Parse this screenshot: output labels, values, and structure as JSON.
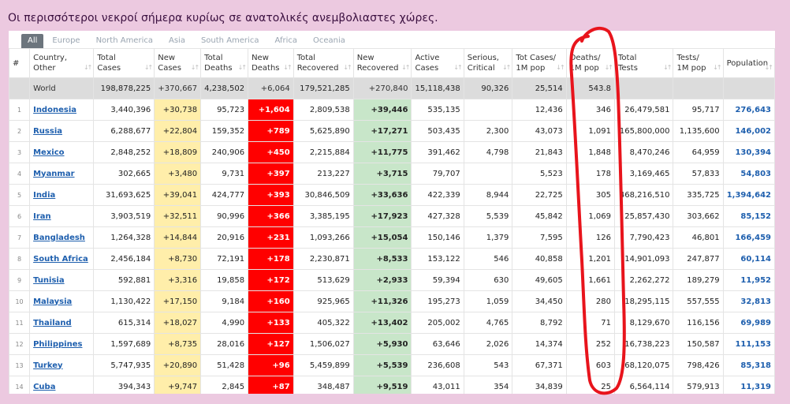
{
  "caption": "Οι περισσότεροι νεκροί σήμερα κυρίως σε ανατολικές ανεμβολιαστες χώρες.",
  "tabs": [
    "All",
    "Europe",
    "North America",
    "Asia",
    "South America",
    "Africa",
    "Oceania"
  ],
  "headers": [
    "#",
    "Country,\nOther",
    "Total\nCases",
    "New\nCases",
    "Total\nDeaths",
    "New\nDeaths",
    "Total\nRecovered",
    "New\nRecovered",
    "Active\nCases",
    "Serious,\nCritical",
    "Tot Cases/\n1M pop",
    "Deaths/\n1M pop",
    "Total\nTests",
    "Tests/\n1M pop",
    "Population"
  ],
  "world": [
    "",
    "World",
    "198,878,225",
    "+370,667",
    "4,238,502",
    "+6,064",
    "179,521,285",
    "+270,840",
    "15,118,438",
    "90,326",
    "25,514",
    "543.8",
    "",
    "",
    ""
  ],
  "rows": [
    [
      "1",
      "Indonesia",
      "3,440,396",
      "+30,738",
      "95,723",
      "+1,604",
      "2,809,538",
      "+39,446",
      "535,135",
      "",
      "12,436",
      "346",
      "26,479,581",
      "95,717",
      "276,643"
    ],
    [
      "2",
      "Russia",
      "6,288,677",
      "+22,804",
      "159,352",
      "+789",
      "5,625,890",
      "+17,271",
      "503,435",
      "2,300",
      "43,073",
      "1,091",
      "165,800,000",
      "1,135,600",
      "146,002"
    ],
    [
      "3",
      "Mexico",
      "2,848,252",
      "+18,809",
      "240,906",
      "+450",
      "2,215,884",
      "+11,775",
      "391,462",
      "4,798",
      "21,843",
      "1,848",
      "8,470,246",
      "64,959",
      "130,394"
    ],
    [
      "4",
      "Myanmar",
      "302,665",
      "+3,480",
      "9,731",
      "+397",
      "213,227",
      "+3,715",
      "79,707",
      "",
      "5,523",
      "178",
      "3,169,465",
      "57,833",
      "54,803"
    ],
    [
      "5",
      "India",
      "31,693,625",
      "+39,041",
      "424,777",
      "+393",
      "30,846,509",
      "+33,636",
      "422,339",
      "8,944",
      "22,725",
      "305",
      "468,216,510",
      "335,725",
      "1,394,642"
    ],
    [
      "6",
      "Iran",
      "3,903,519",
      "+32,511",
      "90,996",
      "+366",
      "3,385,195",
      "+17,923",
      "427,328",
      "5,539",
      "45,842",
      "1,069",
      "25,857,430",
      "303,662",
      "85,152"
    ],
    [
      "7",
      "Bangladesh",
      "1,264,328",
      "+14,844",
      "20,916",
      "+231",
      "1,093,266",
      "+15,054",
      "150,146",
      "1,379",
      "7,595",
      "126",
      "7,790,423",
      "46,801",
      "166,459"
    ],
    [
      "8",
      "South Africa",
      "2,456,184",
      "+8,730",
      "72,191",
      "+178",
      "2,230,871",
      "+8,533",
      "153,122",
      "546",
      "40,858",
      "1,201",
      "14,901,093",
      "247,877",
      "60,114"
    ],
    [
      "9",
      "Tunisia",
      "592,881",
      "+3,316",
      "19,858",
      "+172",
      "513,629",
      "+2,933",
      "59,394",
      "630",
      "49,605",
      "1,661",
      "2,262,272",
      "189,279",
      "11,952"
    ],
    [
      "10",
      "Malaysia",
      "1,130,422",
      "+17,150",
      "9,184",
      "+160",
      "925,965",
      "+11,326",
      "195,273",
      "1,059",
      "34,450",
      "280",
      "18,295,115",
      "557,555",
      "32,813"
    ],
    [
      "11",
      "Thailand",
      "615,314",
      "+18,027",
      "4,990",
      "+133",
      "405,322",
      "+13,402",
      "205,002",
      "4,765",
      "8,792",
      "71",
      "8,129,670",
      "116,156",
      "69,989"
    ],
    [
      "12",
      "Philippines",
      "1,597,689",
      "+8,735",
      "28,016",
      "+127",
      "1,506,027",
      "+5,930",
      "63,646",
      "2,026",
      "14,374",
      "252",
      "16,738,223",
      "150,587",
      "111,153"
    ],
    [
      "13",
      "Turkey",
      "5,747,935",
      "+20,890",
      "51,428",
      "+96",
      "5,459,899",
      "+5,539",
      "236,608",
      "543",
      "67,371",
      "603",
      "68,120,075",
      "798,426",
      "85,318"
    ],
    [
      "14",
      "Cuba",
      "394,343",
      "+9,747",
      "2,845",
      "+87",
      "348,487",
      "+9,519",
      "43,011",
      "354",
      "34,839",
      "25",
      "6,564,114",
      "579,913",
      "11,319"
    ]
  ],
  "colors": {
    "background": "#ecc9e0",
    "new_cases": "#ffeeaa",
    "new_deaths": "#ff0000",
    "new_recovered": "#c8e6c9",
    "world_row": "#dcdcdc",
    "link": "#1e5fae",
    "annotation": "#e8141c"
  },
  "annotation": "red hand-drawn oval around Deaths/1M pop column"
}
